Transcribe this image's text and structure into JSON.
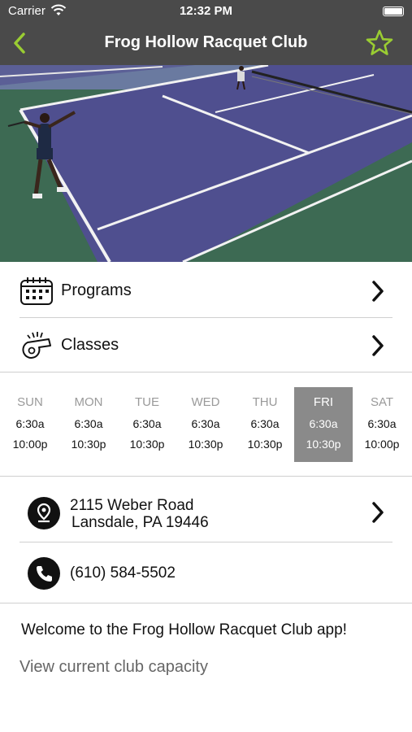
{
  "status": {
    "carrier": "Carrier",
    "time": "12:32 PM"
  },
  "nav": {
    "title": "Frog Hollow Racquet Club"
  },
  "menu": [
    {
      "label": "Programs",
      "icon": "calendar-icon"
    },
    {
      "label": "Classes",
      "icon": "whistle-icon"
    }
  ],
  "hours": [
    {
      "day": "SUN",
      "open": "6:30a",
      "close": "10:00p"
    },
    {
      "day": "MON",
      "open": "6:30a",
      "close": "10:30p"
    },
    {
      "day": "TUE",
      "open": "6:30a",
      "close": "10:30p"
    },
    {
      "day": "WED",
      "open": "6:30a",
      "close": "10:30p"
    },
    {
      "day": "THU",
      "open": "6:30a",
      "close": "10:30p"
    },
    {
      "day": "FRI",
      "open": "6:30a",
      "close": "10:30p",
      "today": true
    },
    {
      "day": "SAT",
      "open": "6:30a",
      "close": "10:00p"
    }
  ],
  "contact": {
    "address_line1": "2115 Weber Road",
    "address_line2": "Lansdale, PA 19446",
    "phone": "(610) 584-5502"
  },
  "welcome": "Welcome to the Frog Hollow Racquet Club app!",
  "capacity_link": "View current club capacity",
  "colors": {
    "accent": "#9acd32",
    "bar": "#4a4a4a",
    "today_bg": "#8a8a8a"
  }
}
